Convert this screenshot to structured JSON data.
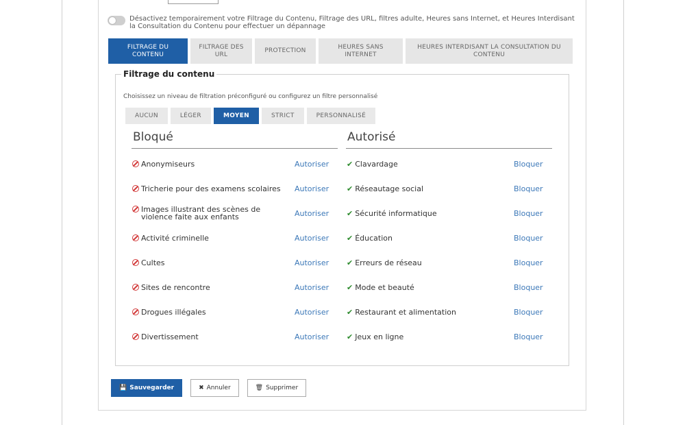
{
  "notice": {
    "text": "Désactivez temporairement votre Filtrage du Contenu, Filtrage des URL, filtres adulte, Heures sans Internet, et Heures Interdisant la Consultation du Contenu pour effectuer un dépannage"
  },
  "tabs": [
    {
      "label": "Filtrage du contenu",
      "active": true
    },
    {
      "label": "Filtrage des URL",
      "active": false
    },
    {
      "label": "Protection",
      "active": false
    },
    {
      "label": "Heures sans Internet",
      "active": false
    },
    {
      "label": "Heures interdisant la consultation du contenu",
      "active": false
    }
  ],
  "content_filter": {
    "legend": "Filtrage du contenu",
    "instruction": "Choisissez un niveau de filtration préconfiguré ou configurez un filtre personnalisé",
    "levels": [
      {
        "label": "AUCUN",
        "active": false
      },
      {
        "label": "LÉGER",
        "active": false
      },
      {
        "label": "MOYEN",
        "active": true
      },
      {
        "label": "STRICT",
        "active": false
      },
      {
        "label": "PERSONNALISÉ",
        "active": false
      }
    ],
    "blocked_heading": "Bloqué",
    "allowed_heading": "Autorisé",
    "allow_label": "Autoriser",
    "block_label": "Bloquer",
    "blocked": [
      "Anonymiseurs",
      "Tricherie pour des examens scolaires",
      "Images illustrant des scènes de violence faite aux enfants",
      "Activité criminelle",
      "Cultes",
      "Sites de rencontre",
      "Drogues illégales",
      "Divertissement"
    ],
    "allowed": [
      "Clavardage",
      "Réseautage social",
      "Sécurité informatique",
      "Éducation",
      "Erreurs de réseau",
      "Mode et beauté",
      "Restaurant et alimentation",
      "Jeux en ligne"
    ]
  },
  "actions": {
    "save": "Sauvegarder",
    "cancel": "Annuler",
    "delete": "Supprimer"
  },
  "colors": {
    "accent": "#1f5fa6",
    "link": "#3c78b8",
    "blocked": "#d23a3a",
    "allowed": "#2e8b2e"
  }
}
